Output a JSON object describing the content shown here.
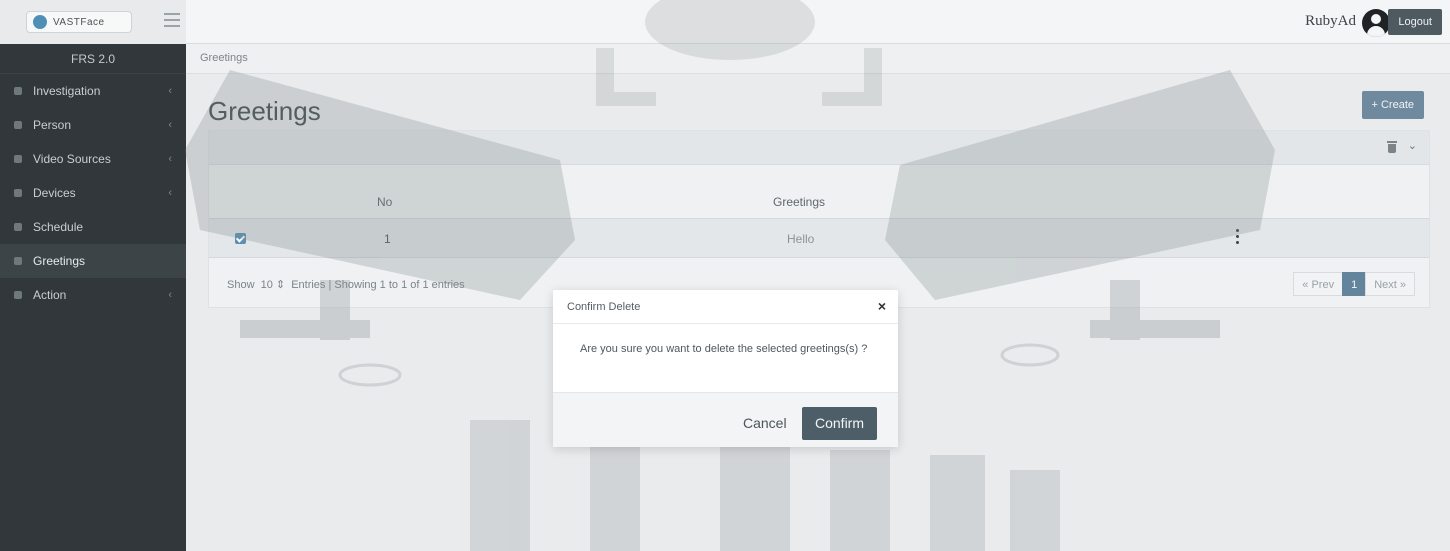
{
  "header": {
    "logo_text": "VASTFace",
    "user_name": "RubyAd",
    "logout_label": "Logout"
  },
  "sidebar": {
    "title": "FRS 2.0",
    "items": [
      {
        "label": "Investigation",
        "has_submenu": true
      },
      {
        "label": "Person",
        "has_submenu": true
      },
      {
        "label": "Video Sources",
        "has_submenu": true
      },
      {
        "label": "Devices",
        "has_submenu": true
      },
      {
        "label": "Schedule",
        "has_submenu": false
      },
      {
        "label": "Greetings",
        "has_submenu": false,
        "active": true
      },
      {
        "label": "Action",
        "has_submenu": true
      }
    ]
  },
  "breadcrumb": "Greetings",
  "page_title": "Greetings",
  "create_label": "+ Create",
  "table": {
    "columns": [
      "No",
      "Greetings"
    ],
    "rows": [
      {
        "no": "1",
        "greeting": "Hello",
        "selected": true
      }
    ]
  },
  "pagination": {
    "show_label": "Show",
    "page_size": "10",
    "entries_label": "Entries",
    "summary": "Showing 1 to 1 of 1 entries",
    "prev_label": "« Prev",
    "current_page": "1",
    "next_label": "Next »"
  },
  "modal": {
    "title": "Confirm Delete",
    "close_glyph": "×",
    "message": "Are you sure you want to delete the selected greetings(s) ?",
    "cancel_label": "Cancel",
    "confirm_label": "Confirm"
  },
  "colors": {
    "sidebar_bg": "#31373a",
    "accent": "#4e5e68",
    "page_active": "#62849d"
  }
}
